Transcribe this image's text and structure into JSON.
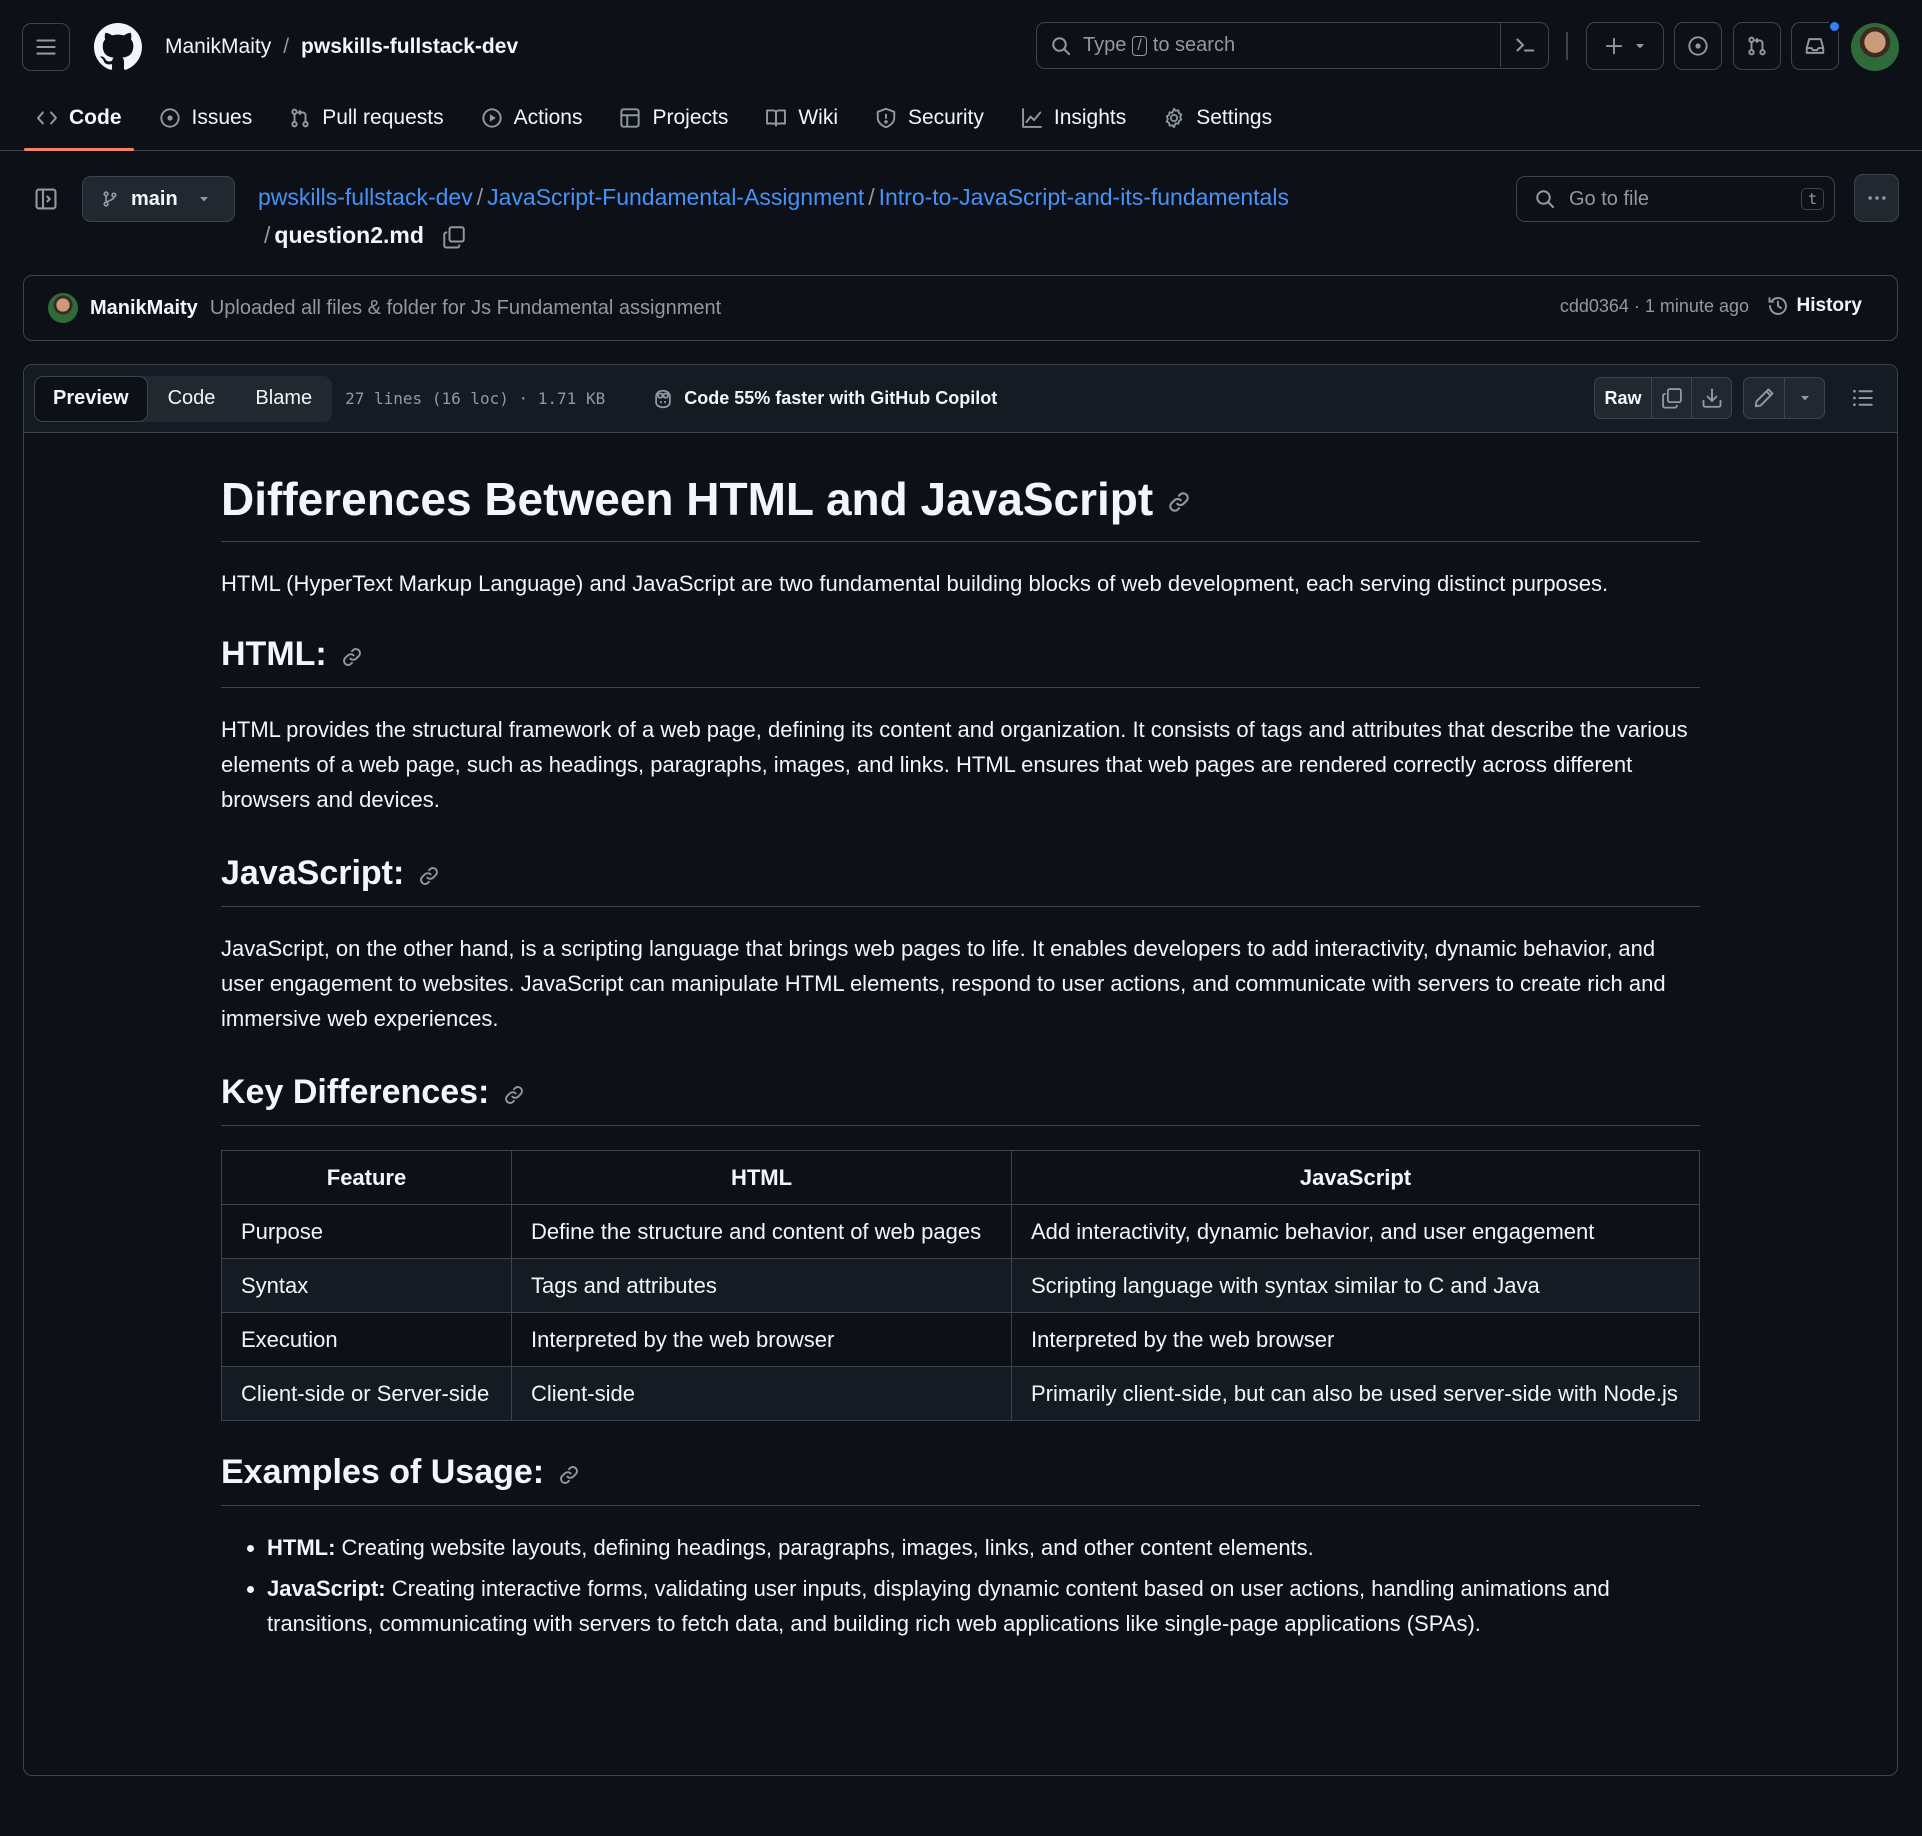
{
  "header": {
    "owner": "ManikMaity",
    "separator": "/",
    "repo": "pwskills-fullstack-dev",
    "search_prefix": "Type",
    "search_key": "/",
    "search_suffix": "to search"
  },
  "nav": {
    "tabs": [
      {
        "label": "Code",
        "icon": "code-icon"
      },
      {
        "label": "Issues",
        "icon": "issue-icon"
      },
      {
        "label": "Pull requests",
        "icon": "pull-request-icon"
      },
      {
        "label": "Actions",
        "icon": "play-icon"
      },
      {
        "label": "Projects",
        "icon": "table-icon"
      },
      {
        "label": "Wiki",
        "icon": "book-icon"
      },
      {
        "label": "Security",
        "icon": "shield-icon"
      },
      {
        "label": "Insights",
        "icon": "graph-icon"
      },
      {
        "label": "Settings",
        "icon": "gear-icon"
      }
    ]
  },
  "file_header": {
    "branch": "main",
    "breadcrumbs": [
      "pwskills-fullstack-dev",
      "JavaScript-Fundamental-Assignment",
      "Intro-to-JavaScript-and-its-fundamentals"
    ],
    "slash": "/",
    "filename": "question2.md",
    "goto_placeholder": "Go to file",
    "goto_key": "t"
  },
  "commit": {
    "author": "ManikMaity",
    "message": "Uploaded all files & folder for Js Fundamental assignment",
    "meta": "cdd0364 · 1 minute ago",
    "history_label": "History"
  },
  "filebar": {
    "tabs": [
      "Preview",
      "Code",
      "Blame"
    ],
    "info": "27 lines (16 loc) · 1.71 KB",
    "copilot": "Code 55% faster with GitHub Copilot",
    "raw_label": "Raw"
  },
  "markdown": {
    "h1": "Differences Between HTML and JavaScript",
    "intro": "HTML (HyperText Markup Language) and JavaScript are two fundamental building blocks of web development, each serving distinct purposes.",
    "html_heading": "HTML:",
    "html_text": "HTML provides the structural framework of a web page, defining its content and organization. It consists of tags and attributes that describe the various elements of a web page, such as headings, paragraphs, images, and links. HTML ensures that web pages are rendered correctly across different browsers and devices.",
    "js_heading": "JavaScript:",
    "js_text": "JavaScript, on the other hand, is a scripting language that brings web pages to life. It enables developers to add interactivity, dynamic behavior, and user engagement to websites. JavaScript can manipulate HTML elements, respond to user actions, and communicate with servers to create rich and immersive web experiences.",
    "kd_heading": "Key Differences:",
    "table": {
      "headers": [
        "Feature",
        "HTML",
        "JavaScript"
      ],
      "rows": [
        [
          "Purpose",
          "Define the structure and content of web pages",
          "Add interactivity, dynamic behavior, and user engagement"
        ],
        [
          "Syntax",
          "Tags and attributes",
          "Scripting language with syntax similar to C and Java"
        ],
        [
          "Execution",
          "Interpreted by the web browser",
          "Interpreted by the web browser"
        ],
        [
          "Client-side or Server-side",
          "Client-side",
          "Primarily client-side, but can also be used server-side with Node.js"
        ]
      ]
    },
    "ex_heading": "Examples of Usage:",
    "examples": [
      {
        "term": "HTML:",
        "text": " Creating website layouts, defining headings, paragraphs, images, links, and other content elements."
      },
      {
        "term": "JavaScript:",
        "text": " Creating interactive forms, validating user inputs, displaying dynamic content based on user actions, handling animations and transitions, communicating with servers to fetch data, and building rich web applications like single-page applications (SPAs)."
      }
    ]
  }
}
